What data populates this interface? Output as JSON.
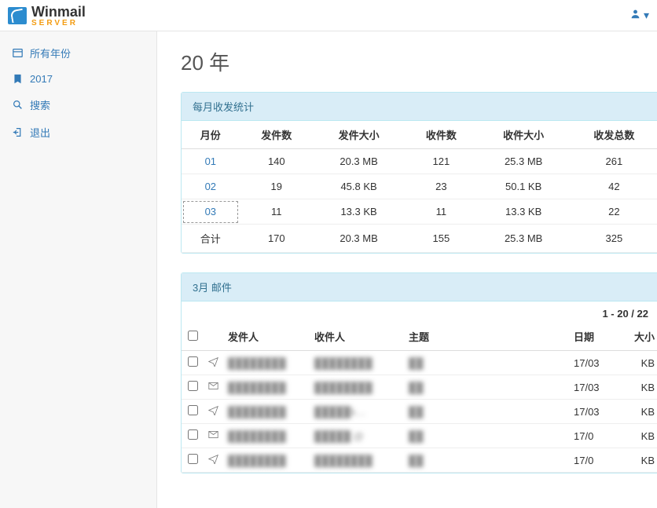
{
  "brand": {
    "name": "Winmail",
    "sub": "SERVER"
  },
  "sidebar": {
    "items": [
      {
        "label": "所有年份",
        "icon": "calendar-all-icon"
      },
      {
        "label": "2017",
        "icon": "bookmark-icon"
      },
      {
        "label": "搜索",
        "icon": "search-icon"
      },
      {
        "label": "退出",
        "icon": "logout-icon"
      }
    ]
  },
  "page": {
    "title": "20   年"
  },
  "stats_panel": {
    "heading": "每月收发统计",
    "columns": [
      "月份",
      "发件数",
      "发件大小",
      "收件数",
      "收件大小",
      "收发总数"
    ],
    "rows": [
      {
        "month": "01",
        "sent": "140",
        "sent_size": "20.3 MB",
        "recv": "121",
        "recv_size": "25.3 MB",
        "total": "261",
        "selected": false
      },
      {
        "month": "02",
        "sent": "19",
        "sent_size": "45.8 KB",
        "recv": "23",
        "recv_size": "50.1 KB",
        "total": "42",
        "selected": false
      },
      {
        "month": "03",
        "sent": "11",
        "sent_size": "13.3 KB",
        "recv": "11",
        "recv_size": "13.3 KB",
        "total": "22",
        "selected": true
      }
    ],
    "total_row": {
      "label": "合计",
      "sent": "170",
      "sent_size": "20.3 MB",
      "recv": "155",
      "recv_size": "25.3 MB",
      "total": "325"
    }
  },
  "mail_panel": {
    "heading": "3月 邮件",
    "range": "1 - 20 / 22",
    "columns": {
      "from": "发件人",
      "to": "收件人",
      "subject": "主题",
      "date": "日期",
      "size": "大小"
    },
    "rows": [
      {
        "icon": "send-icon",
        "from": "████████",
        "to": "████████",
        "subject": "██",
        "date": "17/03",
        "size": "KB"
      },
      {
        "icon": "envelope-icon",
        "from": "████████",
        "to": "████████",
        "subject": "██",
        "date": "17/03",
        "size": "KB"
      },
      {
        "icon": "send-icon",
        "from": "████████",
        "to": "█████k…",
        "subject": "██",
        "date": "17/03",
        "size": "KB"
      },
      {
        "icon": "envelope-icon",
        "from": "████████",
        "to": "█████ @",
        "subject": "██",
        "date": "17/0",
        "size": "KB"
      },
      {
        "icon": "send-icon",
        "from": "████████",
        "to": "████████",
        "subject": "██",
        "date": "17/0",
        "size": "KB"
      }
    ]
  },
  "chart_data": {
    "type": "table",
    "title": "每月收发统计",
    "columns": [
      "月份",
      "发件数",
      "发件大小",
      "收件数",
      "收件大小",
      "收发总数"
    ],
    "rows": [
      [
        "01",
        140,
        "20.3 MB",
        121,
        "25.3 MB",
        261
      ],
      [
        "02",
        19,
        "45.8 KB",
        23,
        "50.1 KB",
        42
      ],
      [
        "03",
        11,
        "13.3 KB",
        11,
        "13.3 KB",
        22
      ],
      [
        "合计",
        170,
        "20.3 MB",
        155,
        "25.3 MB",
        325
      ]
    ]
  }
}
